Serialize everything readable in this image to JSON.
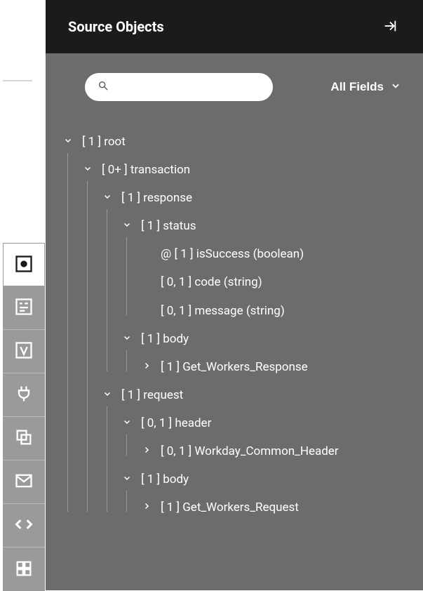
{
  "header": {
    "title": "Source Objects"
  },
  "search": {
    "placeholder": ""
  },
  "filter": {
    "label": "All Fields"
  },
  "sidebar_icons": [
    {
      "name": "target-square-icon"
    },
    {
      "name": "form-list-icon"
    },
    {
      "name": "variable-v-icon"
    },
    {
      "name": "plug-icon"
    },
    {
      "name": "stack-copy-icon"
    },
    {
      "name": "envelope-icon"
    },
    {
      "name": "code-icon"
    },
    {
      "name": "grid-apps-icon"
    }
  ],
  "tree": [
    {
      "label": "[ 1 ] root",
      "expanded": true,
      "children": [
        {
          "label": "[ 0+ ] transaction",
          "expanded": true,
          "children": [
            {
              "label": "[ 1 ] response",
              "expanded": true,
              "children": [
                {
                  "label": "[ 1 ] status",
                  "expanded": true,
                  "children": [
                    {
                      "label": "@ [ 1 ] isSuccess (boolean)",
                      "leaf": true
                    },
                    {
                      "label": "[ 0, 1 ] code (string)",
                      "leaf": true
                    },
                    {
                      "label": "[ 0, 1 ] message (string)",
                      "leaf": true
                    }
                  ]
                },
                {
                  "label": "[ 1 ] body",
                  "expanded": true,
                  "children": [
                    {
                      "label": "[ 1 ] Get_Workers_Response",
                      "expanded": false,
                      "children": []
                    }
                  ]
                }
              ]
            },
            {
              "label": "[ 1 ] request",
              "expanded": true,
              "children": [
                {
                  "label": "[ 0, 1 ] header",
                  "expanded": true,
                  "children": [
                    {
                      "label": "[ 0, 1 ] Workday_Common_Header",
                      "expanded": false,
                      "children": []
                    }
                  ]
                },
                {
                  "label": "[ 1 ] body",
                  "expanded": true,
                  "children": [
                    {
                      "label": "[ 1 ] Get_Workers_Request",
                      "expanded": false,
                      "children": []
                    }
                  ]
                }
              ]
            }
          ]
        }
      ]
    }
  ]
}
